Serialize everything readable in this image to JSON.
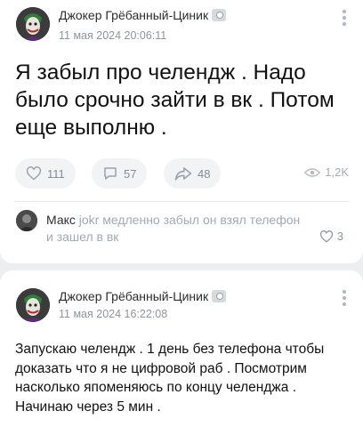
{
  "posts": [
    {
      "author": "Джокер Грёбанный-Циник",
      "date": "11 мая 2024 20:06:11",
      "text": "Я забыл про челендж . Надо было срочно зайти в вк . Потом еще выполню .",
      "likes": "111",
      "comments": "57",
      "reposts": "48",
      "views": "1,2K",
      "top_comment": {
        "name": "Макс",
        "text": "jokr медленно забыл он взял телефон и зашел в вк",
        "likes": "3"
      }
    },
    {
      "author": "Джокер Грёбанный-Циник",
      "date": "11 мая 2024 16:22:08",
      "text": "Запускаю челендж . 1 день без телефона чтобы доказать что я не цифровой раб . Посмотрим насколько япоменяюсь по концу челенджа . Начинаю через 5 мин ."
    }
  ],
  "colors": {
    "background": "#edeef0",
    "card": "#ffffff",
    "secondary_text": "#8e959c",
    "action_bg": "#f2f3f5"
  },
  "icons": {
    "author_badge": "camera-badge-icon",
    "menu": "more-vertical-icon",
    "like": "heart-icon",
    "comment": "comment-icon",
    "repost": "share-arrow-icon",
    "views": "eye-icon"
  }
}
